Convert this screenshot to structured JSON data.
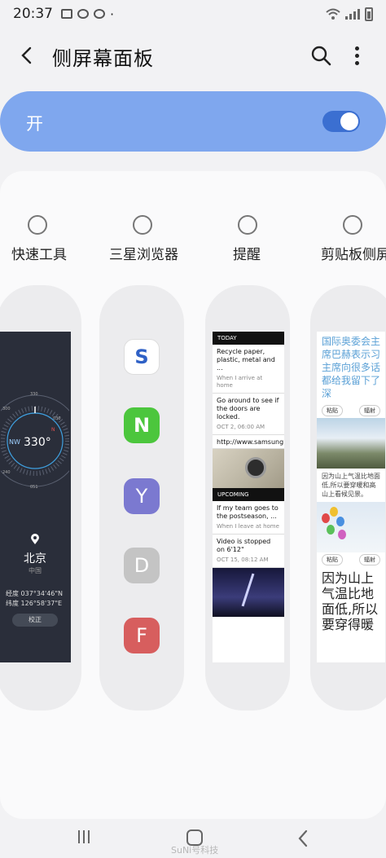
{
  "status": {
    "time": "20:37",
    "extra_dot": "·"
  },
  "appbar": {
    "title": "侧屏幕面板"
  },
  "master": {
    "label": "开",
    "on": true
  },
  "panels": [
    {
      "label": "快速工具",
      "selected": false
    },
    {
      "label": "三星浏览器",
      "selected": false
    },
    {
      "label": "提醒",
      "selected": false
    },
    {
      "label": "剪贴板侧屏",
      "selected": false
    }
  ],
  "compass": {
    "heading": "330°",
    "dir": "NW",
    "city": "北京",
    "country": "中国",
    "lon": "经度 037°34'46\"N",
    "lat": "纬度 126°58'37\"E",
    "calib": "校正",
    "ticks": [
      "330",
      "300",
      "030",
      "051",
      "240"
    ]
  },
  "browser": {
    "icons": [
      {
        "letter": "S",
        "color": "#ffffff",
        "fg": "#2f61c6"
      },
      {
        "letter": "N",
        "color": "#4cc63d",
        "fg": "#ffffff"
      },
      {
        "letter": "Y",
        "color": "#7b79d0",
        "fg": "#ffffff"
      },
      {
        "letter": "D",
        "color": "#c4c4c4",
        "fg": "#ffffff"
      },
      {
        "letter": "F",
        "color": "#d75e5e",
        "fg": "#ffffff"
      }
    ]
  },
  "reminder": {
    "today": "TODAY",
    "upcoming": "UPCOMING",
    "items": [
      {
        "text": "Recycle paper, plastic, metal and ...",
        "sub": "When I arrive at home"
      },
      {
        "text": "Go around to see if the doors are locked.",
        "sub": "OCT 2, 06:00 AM"
      },
      {
        "text": "http://www.samsung.com",
        "sub": ""
      },
      {
        "text": "If my team goes to the postseason, ...",
        "sub": "When I leave at home"
      },
      {
        "text": "Video is stopped on 6'12\"",
        "sub": "OCT 15, 08:12 AM"
      }
    ]
  },
  "clipboard": {
    "text1": "国际奥委会主席巴赫表示习主席向很多话都给我留下了深",
    "paste": "粘贴",
    "copy": "辐射",
    "small": "因为山上气温比地面低,所以要穿暖和高山上看候见景。",
    "big": "因为山上气温比地面低,所以要穿得暖"
  },
  "watermark": "SuNi号科技"
}
